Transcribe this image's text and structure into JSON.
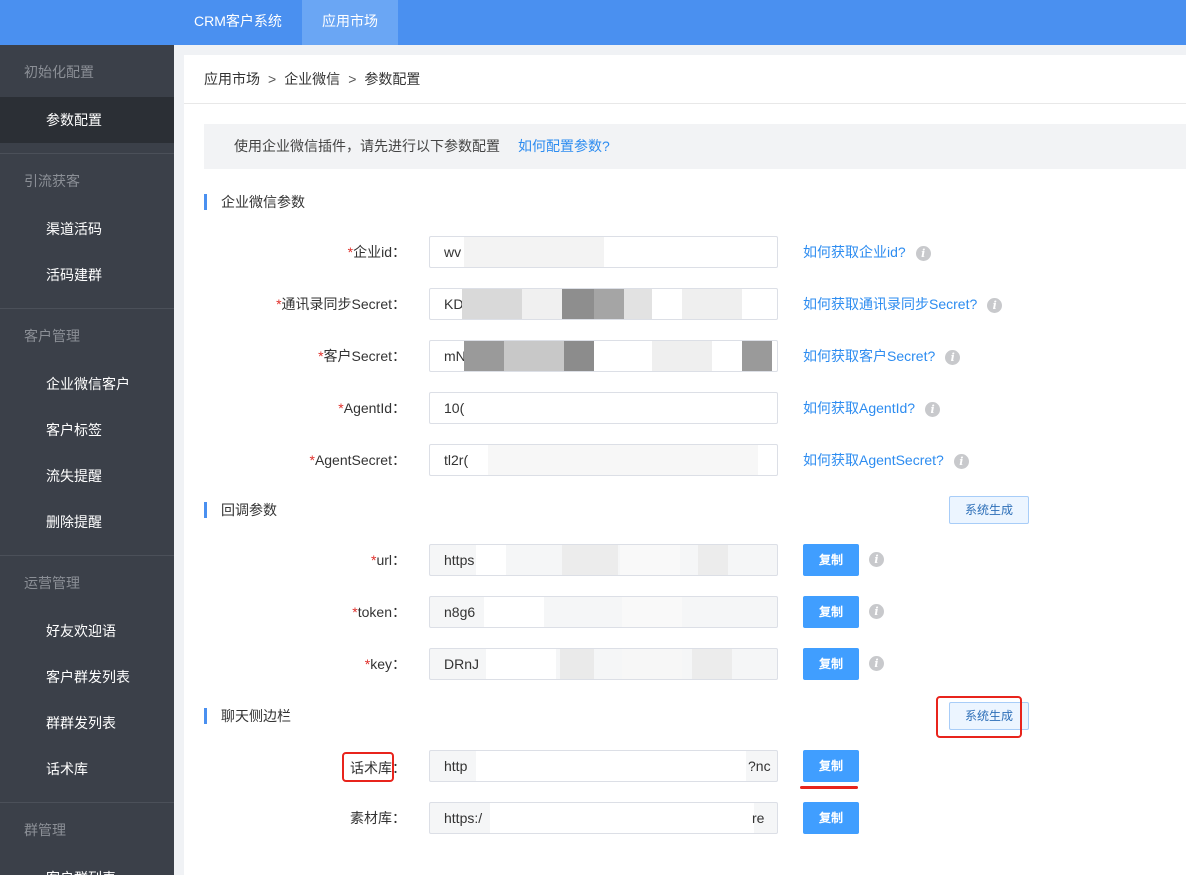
{
  "topbar": {
    "tabs": [
      {
        "label": "CRM客户系统"
      },
      {
        "label": "应用市场"
      }
    ]
  },
  "sidebar": {
    "groups": [
      {
        "title": "初始化配置",
        "items": [
          {
            "label": "参数配置",
            "active": true
          }
        ]
      },
      {
        "title": "引流获客",
        "items": [
          {
            "label": "渠道活码"
          },
          {
            "label": "活码建群"
          }
        ]
      },
      {
        "title": "客户管理",
        "items": [
          {
            "label": "企业微信客户"
          },
          {
            "label": "客户标签"
          },
          {
            "label": "流失提醒"
          },
          {
            "label": "删除提醒"
          }
        ]
      },
      {
        "title": "运营管理",
        "items": [
          {
            "label": "好友欢迎语"
          },
          {
            "label": "客户群发列表"
          },
          {
            "label": "群群发列表"
          },
          {
            "label": "话术库"
          }
        ]
      },
      {
        "title": "群管理",
        "items": [
          {
            "label": "客户群列表"
          }
        ]
      }
    ]
  },
  "breadcrumb": {
    "items": [
      "应用市场",
      "企业微信",
      "参数配置"
    ],
    "separator": ">"
  },
  "tip": {
    "text": "使用企业微信插件，请先进行以下参数配置",
    "link": "如何配置参数?"
  },
  "sections": {
    "wecom": {
      "title": "企业微信参数",
      "fields": [
        {
          "label": "企业id：",
          "value": "wv",
          "help": "如何获取企业id?"
        },
        {
          "label": "通讯录同步Secret：",
          "value": "KD",
          "help": "如何获取通讯录同步Secret?"
        },
        {
          "label": "客户Secret：",
          "value": "mN",
          "help": "如何获取客户Secret?"
        },
        {
          "label": "AgentId：",
          "value": "10(",
          "help": "如何获取AgentId?"
        },
        {
          "label": "AgentSecret：",
          "value": "tl2r(",
          "help": "如何获取AgentSecret?"
        }
      ]
    },
    "callback": {
      "title": "回调参数",
      "generate_label": "系统生成",
      "fields": [
        {
          "label": "url：",
          "value": "https",
          "copy": "复制"
        },
        {
          "label": "token：",
          "value": "n8g6",
          "copy": "复制"
        },
        {
          "label": "key：",
          "value": "DRnJ",
          "copy": "复制"
        }
      ]
    },
    "sidebar_chat": {
      "title": "聊天侧边栏",
      "generate_label": "系统生成",
      "fields": [
        {
          "label": "话术库：",
          "value": "http",
          "value_end": "?nc",
          "copy": "复制"
        },
        {
          "label": "素材库：",
          "value": "https:/",
          "value_end": "re",
          "copy": "复制"
        }
      ]
    }
  },
  "required_mark": "*",
  "info_glyph": "i",
  "colors": {
    "topbar": "#4a90f0",
    "sidebar": "#3b4049",
    "link": "#2d8cf0",
    "button": "#409eff",
    "required": "#e0302b",
    "annotation": "#e8241c"
  }
}
